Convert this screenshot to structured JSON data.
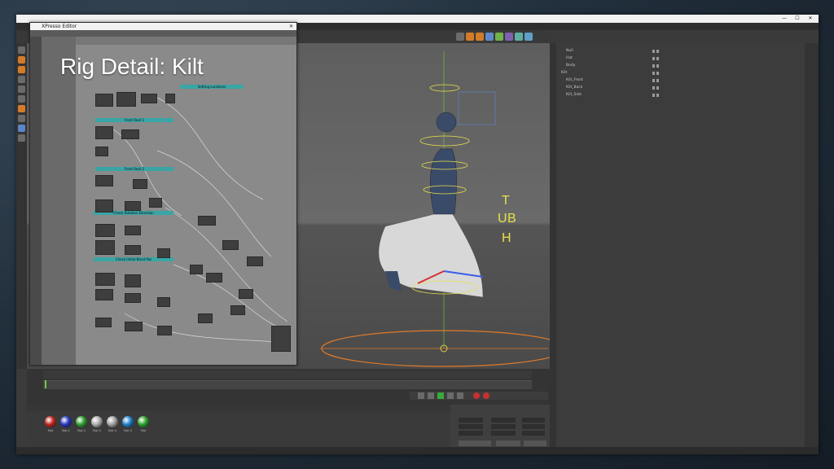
{
  "overlay_title": "Rig Detail: Kilt",
  "main_window": {
    "controls": {
      "minimize": "—",
      "maximize": "☐",
      "close": "✕"
    }
  },
  "xpresso_window": {
    "title": "XPresso Editor",
    "graph": {
      "groups": [
        {
          "label": "Setting Locations"
        },
        {
          "label": "Front Root 1"
        },
        {
          "label": "Front Root 2"
        },
        {
          "label": "Check Rotation Direction"
        },
        {
          "label": "Check Initial Bend Pos"
        }
      ]
    }
  },
  "viewport": {
    "gizmo_letters": {
      "t": "T",
      "u": "U",
      "b": "B",
      "h": "H"
    }
  },
  "materials": [
    {
      "label": "Mat",
      "color": "#c0201a"
    },
    {
      "label": "Mat.1",
      "color": "#2234b8"
    },
    {
      "label": "Mat.2",
      "color": "#2a9a2a"
    },
    {
      "label": "Mat.3",
      "color": "#a9a9a9"
    },
    {
      "label": "Mat.4",
      "color": "#9c9c9c"
    },
    {
      "label": "Mat.5",
      "color": "#1c7ec8"
    },
    {
      "label": "Mat",
      "color": "#28a028"
    }
  ],
  "object_manager": {
    "rows": [
      {
        "label": "Null",
        "depth": 1
      },
      {
        "label": "Hat",
        "depth": 1
      },
      {
        "label": "Body",
        "depth": 1
      },
      {
        "label": "Kilt",
        "depth": 0
      },
      {
        "label": "Kilt_Front",
        "depth": 1
      },
      {
        "label": "Kilt_Back",
        "depth": 1
      },
      {
        "label": "Kilt_Side",
        "depth": 1
      }
    ]
  },
  "colors": {
    "window_bg": "#3b3b3b",
    "node_header": "#3aa5a5",
    "gizmo_yellow": "#e8e04a",
    "orange_spline": "#e07a2a"
  }
}
